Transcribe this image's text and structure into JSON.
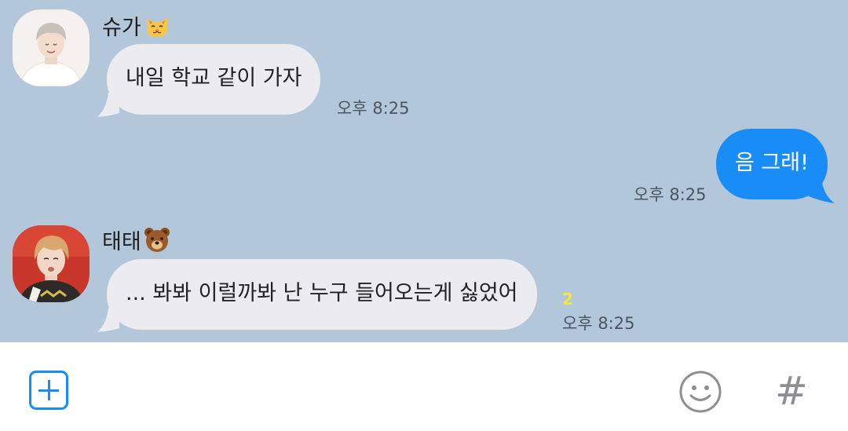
{
  "messages": [
    {
      "sender": "슈가",
      "sender_emoji": "cat-face-emoji",
      "text": "내일 학교 같이 가자",
      "time": "오후 8:25",
      "direction": "incoming"
    },
    {
      "text": "음 그래!",
      "time": "오후 8:25",
      "direction": "outgoing"
    },
    {
      "sender": "태태",
      "sender_emoji": "bear-face-emoji",
      "text": "... 봐봐 이럴까봐 난 누구 들어오는게 싫었어",
      "time": "오후 8:25",
      "unread": "2",
      "direction": "incoming"
    }
  ],
  "input_bar": {
    "plus_icon": "plus-icon",
    "emoji_icon": "smiley-icon",
    "hash_label": "#"
  },
  "colors": {
    "chat_background": "#b2c7da",
    "incoming_bubble": "#ececf0",
    "outgoing_bubble": "#1a8cf6",
    "unread_count": "#f4e63c",
    "accent": "#1a8cf6"
  }
}
